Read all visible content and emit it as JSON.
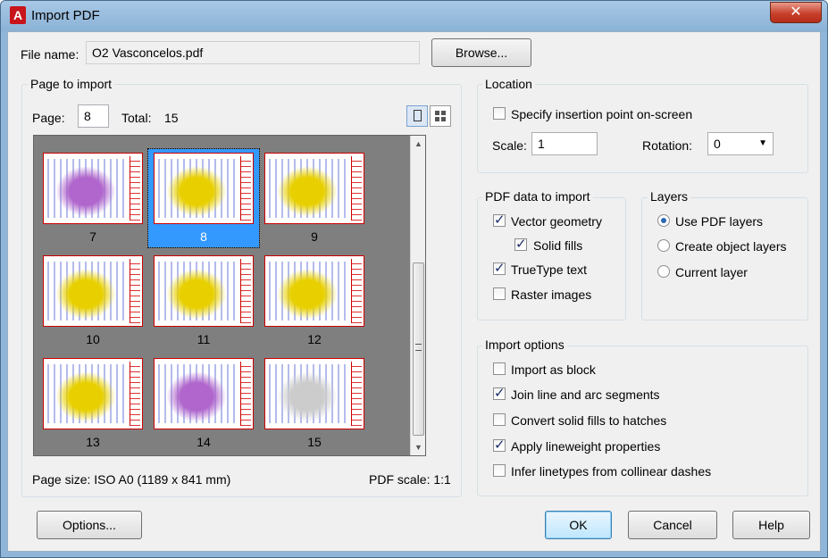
{
  "window": {
    "title": "Import PDF",
    "close_symbol": "✕",
    "app_icon_glyph": "A"
  },
  "file": {
    "label": "File name:",
    "value": "O2 Vasconcelos.pdf",
    "browse_label": "Browse..."
  },
  "page_group": {
    "title": "Page to import",
    "page_label": "Page:",
    "page_value": "8",
    "total_label": "Total:",
    "total_value": "15",
    "thumbnails": [
      {
        "num": "7",
        "selected": false,
        "color": "#b066cc"
      },
      {
        "num": "8",
        "selected": true,
        "color": "#e8d000"
      },
      {
        "num": "9",
        "selected": false,
        "color": "#e8d000"
      },
      {
        "num": "10",
        "selected": false,
        "color": "#e8d000"
      },
      {
        "num": "11",
        "selected": false,
        "color": "#e8d000"
      },
      {
        "num": "12",
        "selected": false,
        "color": "#e8d000"
      },
      {
        "num": "13",
        "selected": false,
        "color": "#e8d000"
      },
      {
        "num": "14",
        "selected": false,
        "color": "#b066cc"
      },
      {
        "num": "15",
        "selected": false,
        "color": "#cccccc"
      }
    ],
    "page_size": "Page size:  ISO A0 (1189 x 841 mm)",
    "pdf_scale": "PDF scale:  1:1"
  },
  "location": {
    "title": "Location",
    "specify_label": "Specify insertion point on-screen",
    "specify_checked": false,
    "scale_label": "Scale:",
    "scale_value": "1",
    "rotation_label": "Rotation:",
    "rotation_value": "0"
  },
  "pdf_data": {
    "title": "PDF data to import",
    "items": [
      {
        "label": "Vector geometry",
        "checked": true
      },
      {
        "label": "Solid fills",
        "checked": true
      },
      {
        "label": "TrueType text",
        "checked": true
      },
      {
        "label": "Raster images",
        "checked": false
      }
    ]
  },
  "layers": {
    "title": "Layers",
    "items": [
      {
        "label": "Use PDF layers",
        "selected": true
      },
      {
        "label": "Create object layers",
        "selected": false
      },
      {
        "label": "Current layer",
        "selected": false
      }
    ]
  },
  "import_options": {
    "title": "Import options",
    "items": [
      {
        "label": "Import as block",
        "checked": false
      },
      {
        "label": "Join line and arc segments",
        "checked": true
      },
      {
        "label": "Convert solid fills to hatches",
        "checked": false
      },
      {
        "label": "Apply lineweight properties",
        "checked": true
      },
      {
        "label": "Infer linetypes from collinear dashes",
        "checked": false
      }
    ]
  },
  "buttons": {
    "options": "Options...",
    "ok": "OK",
    "cancel": "Cancel",
    "help": "Help"
  }
}
